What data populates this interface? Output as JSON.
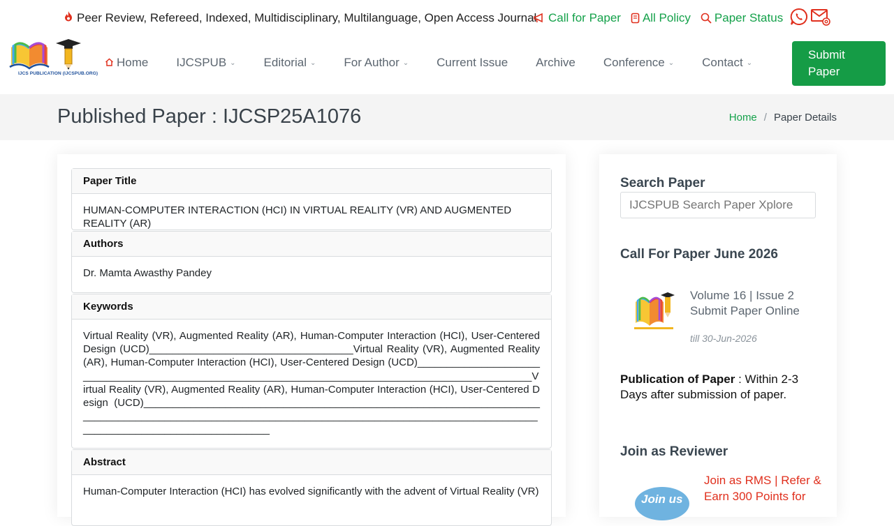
{
  "topbar": {
    "tagline": "Peer Review, Refereed, Indexed, Multidisciplinary, Multilanguage, Open Access Journal",
    "links": [
      {
        "label": "Call for Paper",
        "icon": "megaphone-icon"
      },
      {
        "label": "All Policy",
        "icon": "document-icon"
      },
      {
        "label": "Paper Status",
        "icon": "search-icon"
      }
    ]
  },
  "logo": {
    "text": "IJCS PUBLICATION (IJCSPUB.ORG)"
  },
  "nav": {
    "items": [
      {
        "label": "Home",
        "icon": "home-icon",
        "dropdown": false
      },
      {
        "label": "IJCSPUB",
        "dropdown": true
      },
      {
        "label": "Editorial",
        "dropdown": true
      },
      {
        "label": "For Author",
        "dropdown": true
      },
      {
        "label": "Current Issue",
        "dropdown": false
      },
      {
        "label": "Archive",
        "dropdown": false
      },
      {
        "label": "Conference",
        "dropdown": true
      },
      {
        "label": "Contact",
        "dropdown": true
      }
    ],
    "submit_label": "Submit Paper"
  },
  "page": {
    "title": "Published Paper : IJCSP25A1076",
    "breadcrumb": {
      "home": "Home",
      "separator": "/",
      "current": "Paper Details"
    }
  },
  "paper": {
    "title_label": "Paper Title",
    "title": "HUMAN-COMPUTER INTERACTION (HCI) IN VIRTUAL REALITY (VR) AND AUGMENTED REALITY (AR)",
    "authors_label": "Authors",
    "authors": "Dr. Mamta Awasthy Pandey",
    "keywords_label": "Keywords",
    "keywords": "Virtual Reality (VR), Augmented Reality (AR), Human-Computer Interaction (HCI), User-Centered Design (UCD)___________________________________Virtual Reality (VR), Augmented Reality (AR), Human-Computer Interaction (HCI), User-Centered Design (UCD)__________________________________________________________________________________________________Virtual Reality (VR), Augmented Reality (AR), Human-Computer Interaction (HCI), User-Centered Design (UCD)__________________________________________________________________________________________________________________________________________________________________________________",
    "abstract_label": "Abstract",
    "abstract": "Human-Computer Interaction (HCI) has evolved significantly with the advent of Virtual Reality (VR)"
  },
  "sidebar": {
    "search_heading": "Search Paper",
    "search_placeholder": "IJCSPUB Search Paper Xplore",
    "cfp_heading": "Call For Paper June 2026",
    "cfp_line1": "Volume 16 | Issue 2",
    "cfp_line2": "Submit Paper Online",
    "cfp_till": "till 30-Jun-2026",
    "pub_label": "Publication of Paper",
    "pub_text": " : Within 2-3 Days after submission of paper.",
    "reviewer_heading": "Join as Reviewer",
    "reviewer_text": "Join as RMS | Refer & Earn 300 Points for",
    "badge_text": "Join us"
  },
  "colors": {
    "accent": "#14a14a",
    "button": "#159c46",
    "icon_red": "#e0301e",
    "band": "#f4f4f4"
  }
}
